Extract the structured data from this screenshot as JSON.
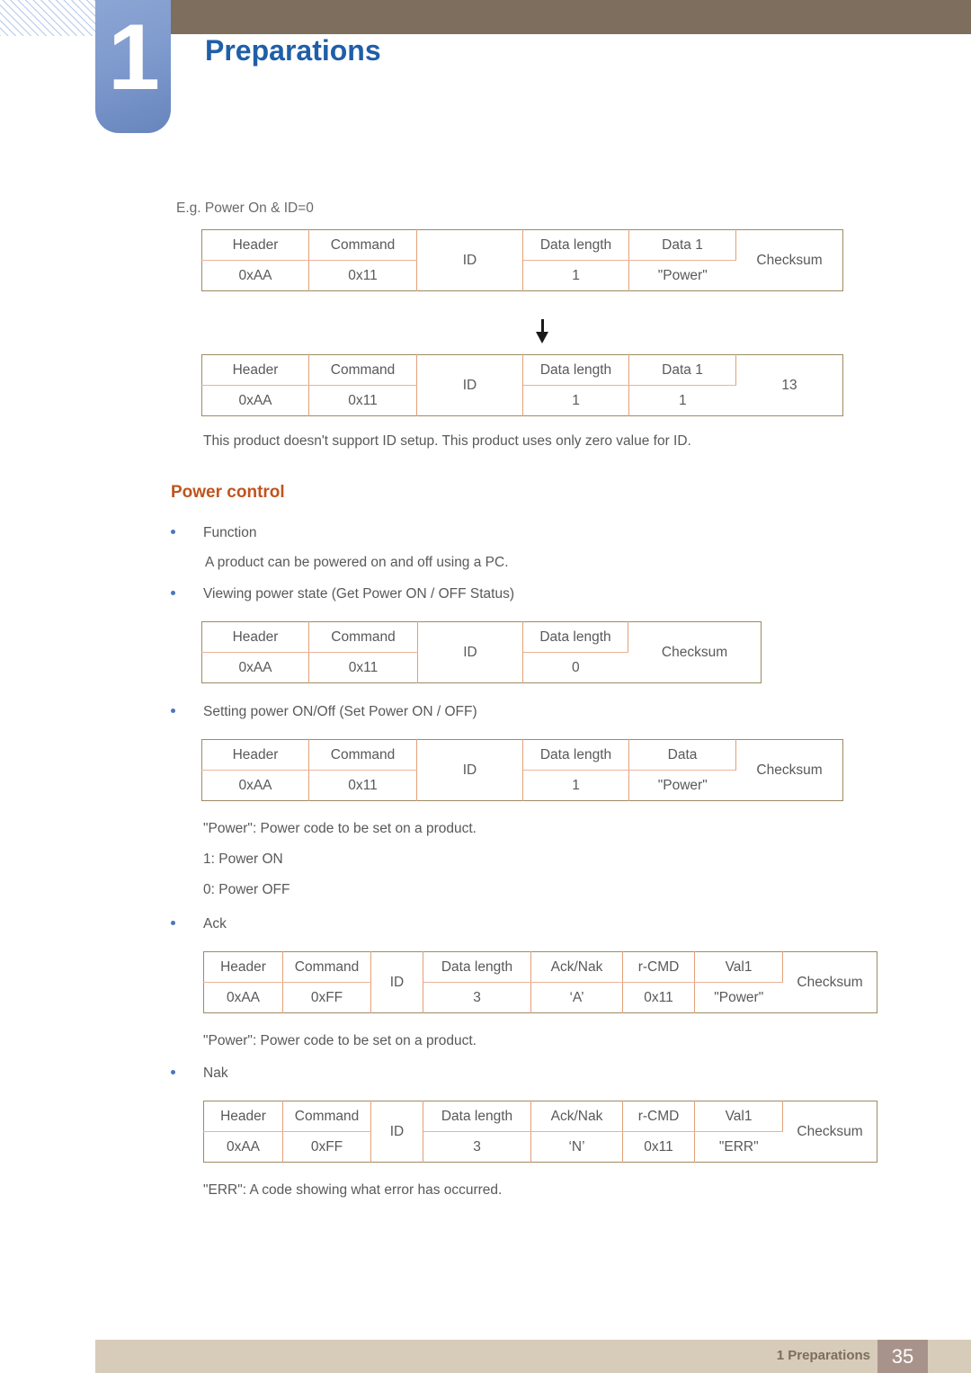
{
  "header": {
    "chapter_number": "1",
    "chapter_title": "Preparations",
    "brand_blue": "#1f5fa8",
    "bar_brown": "#7d6e5e"
  },
  "content": {
    "example_caption": "E.g. Power On & ID=0",
    "id_note": "This product doesn't support ID setup. This product uses only zero value for ID.",
    "section_heading": "Power control",
    "section_heading_color": "#c0541e",
    "bullets": {
      "function": "Function",
      "viewing_power_state": "Viewing power state (Get Power ON / OFF Status)",
      "setting_power": "Setting power ON/Off (Set Power ON / OFF)",
      "ack": "Ack",
      "nak": "Nak"
    },
    "function_desc": "A product can be powered on and off using a PC.",
    "power_code_note_1": "\"Power\": Power code to be set on a product.",
    "power_on_line": "1: Power ON",
    "power_off_line": "0: Power OFF",
    "power_code_note_2": "\"Power\": Power code to be set on a product.",
    "err_note": "\"ERR\": A code showing what error has occurred."
  },
  "tables": {
    "example_request": {
      "headers": [
        "Header",
        "Command",
        "ID",
        "Data length",
        "Data 1",
        "Checksum"
      ],
      "values": [
        "0xAA",
        "0x11",
        "",
        "1",
        "\"Power\"",
        ""
      ]
    },
    "example_response": {
      "headers": [
        "Header",
        "Command",
        "ID",
        "Data length",
        "Data 1",
        "13"
      ],
      "values": [
        "0xAA",
        "0x11",
        "",
        "1",
        "1",
        ""
      ]
    },
    "get_power_status": {
      "headers": [
        "Header",
        "Command",
        "ID",
        "Data length",
        "Checksum"
      ],
      "values": [
        "0xAA",
        "0x11",
        "",
        "0",
        ""
      ]
    },
    "set_power": {
      "headers": [
        "Header",
        "Command",
        "ID",
        "Data length",
        "Data",
        "Checksum"
      ],
      "values": [
        "0xAA",
        "0x11",
        "",
        "1",
        "\"Power\"",
        ""
      ]
    },
    "ack": {
      "headers": [
        "Header",
        "Command",
        "ID",
        "Data length",
        "Ack/Nak",
        "r-CMD",
        "Val1",
        "Checksum"
      ],
      "values": [
        "0xAA",
        "0xFF",
        "",
        "3",
        "‘A’",
        "0x11",
        "\"Power\"",
        ""
      ]
    },
    "nak": {
      "headers": [
        "Header",
        "Command",
        "ID",
        "Data length",
        "Ack/Nak",
        "r-CMD",
        "Val1",
        "Checksum"
      ],
      "values": [
        "0xAA",
        "0xFF",
        "",
        "3",
        "‘N’",
        "0x11",
        "\"ERR\"",
        ""
      ]
    }
  },
  "footer": {
    "label": "1 Preparations",
    "page_number": "35"
  }
}
